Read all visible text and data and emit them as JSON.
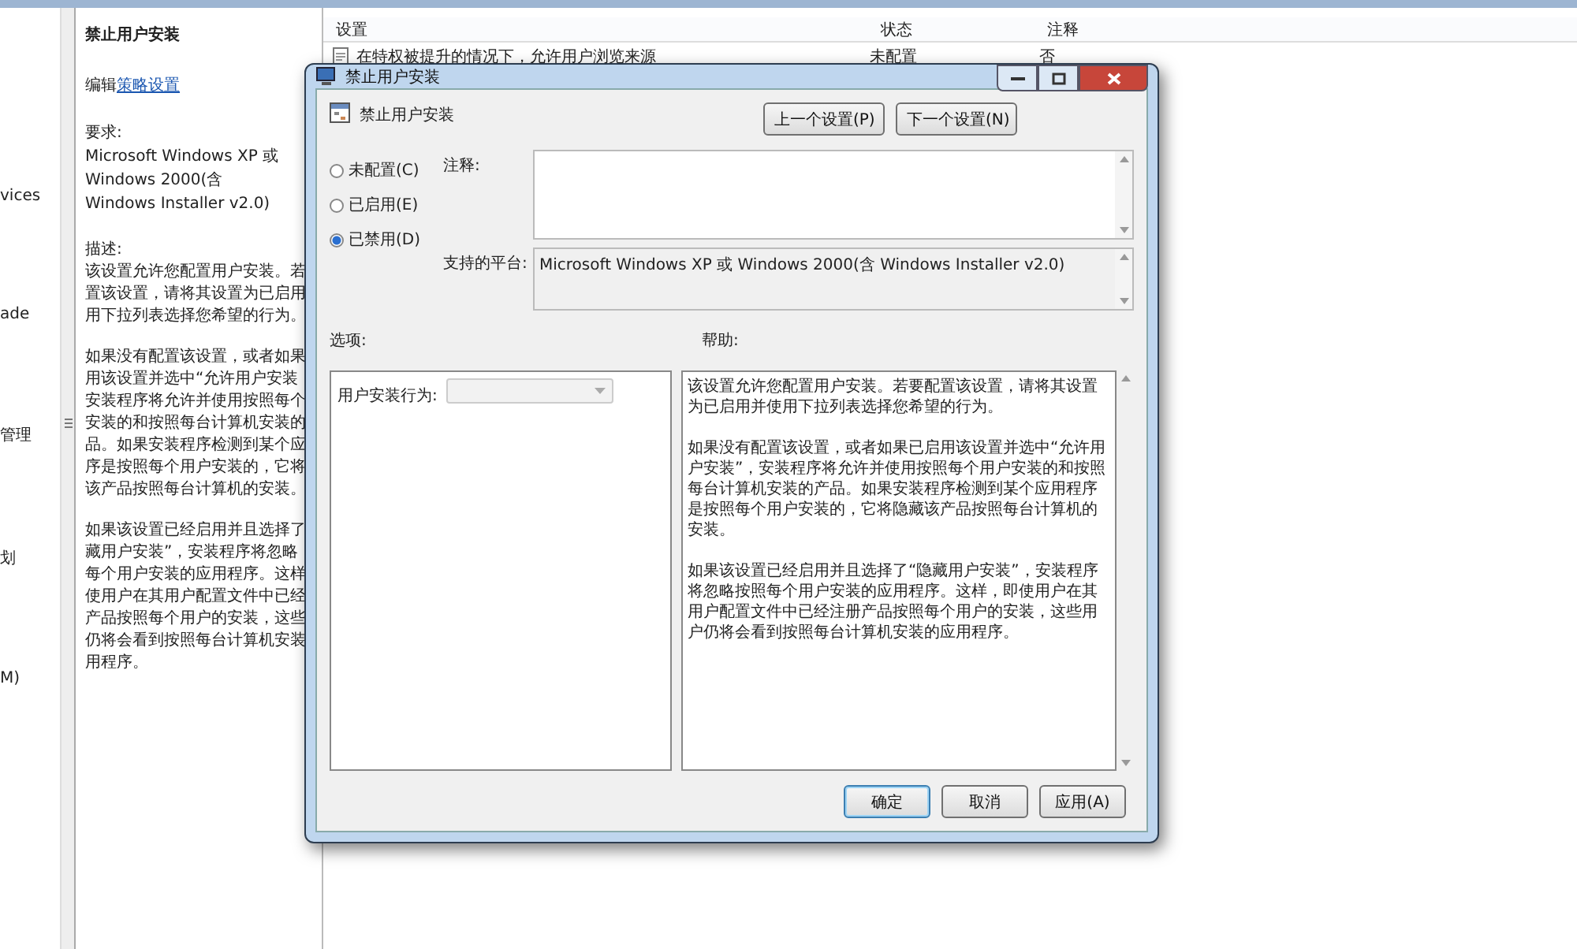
{
  "tree": {
    "items": [
      "vices",
      "ade",
      "管理",
      "划",
      "M)"
    ]
  },
  "description_pane": {
    "title": "禁止用户安装",
    "edit_prefix": "编辑",
    "edit_link": "策略设置",
    "requirements_label": "要求:",
    "requirements": "Microsoft Windows XP 或 Windows 2000(含 Windows Installer v2.0)",
    "description_label": "描述:",
    "paragraphs": [
      [
        "该设置允许您配置用户安装。若",
        "置该设置，请将其设置为已启用",
        "用下拉列表选择您希望的行为。"
      ],
      [
        "如果没有配置该设置，或者如果",
        "用该设置并选中“允许用户安装",
        "安装程序将允许并使用按照每个",
        "安装的和按照每台计算机安装的",
        "品。如果安装程序检测到某个应",
        "序是按照每个用户安装的，它将",
        "该产品按照每台计算机的安装。"
      ],
      [
        "如果该设置已经启用并且选择了",
        "藏用户安装”，安装程序将忽略",
        "每个用户安装的应用程序。这样",
        "使用户在其用户配置文件中已经",
        "产品按照每个用户的安装，这些",
        "仍将会看到按照每台计算机安装",
        "用程序。"
      ]
    ]
  },
  "settings_list": {
    "columns": [
      "设置",
      "状态",
      "注释"
    ],
    "rows": [
      {
        "name": "在特权被提升的情况下，允许用户浏览来源",
        "state": "未配置",
        "comment": "否"
      }
    ]
  },
  "dialog": {
    "title": "禁止用户安装",
    "setting_name": "禁止用户安装",
    "nav_buttons": [
      "上一个设置(P)",
      "下一个设置(N)"
    ],
    "radios": [
      {
        "label": "未配置(C)",
        "selected": false
      },
      {
        "label": "已启用(E)",
        "selected": false
      },
      {
        "label": "已禁用(D)",
        "selected": true
      }
    ],
    "comment_label": "注释:",
    "platform_label": "支持的平台:",
    "platform": "Microsoft Windows XP 或 Windows 2000(含 Windows Installer v2.0)",
    "options_label": "选项:",
    "help_label": "帮助:",
    "option_field_label": "用户安装行为:",
    "help": [
      "该设置允许您配置用户安装。若要配置该设置，请将其设置为已启用并使用下拉列表选择您希望的行为。",
      "如果没有配置该设置，或者如果已启用该设置并选中“允许用户安装”，安装程序将允许并使用按照每个用户安装的和按照每台计算机安装的产品。如果安装程序检测到某个应用程序是按照每个用户安装的，它将隐藏该产品按照每台计算机的安装。",
      "如果该设置已经启用并且选择了“隐藏用户安装”，安装程序将忽略按照每个用户安装的应用程序。这样，即使用户在其用户配置文件中已经注册产品按照每个用户的安装，这些用户仍将会看到按照每台计算机安装的应用程序。"
    ],
    "buttons": [
      {
        "label": "确定",
        "kind": "default"
      },
      {
        "label": "取消",
        "kind": "normal"
      },
      {
        "label": "应用(A)",
        "kind": "normal"
      }
    ]
  }
}
